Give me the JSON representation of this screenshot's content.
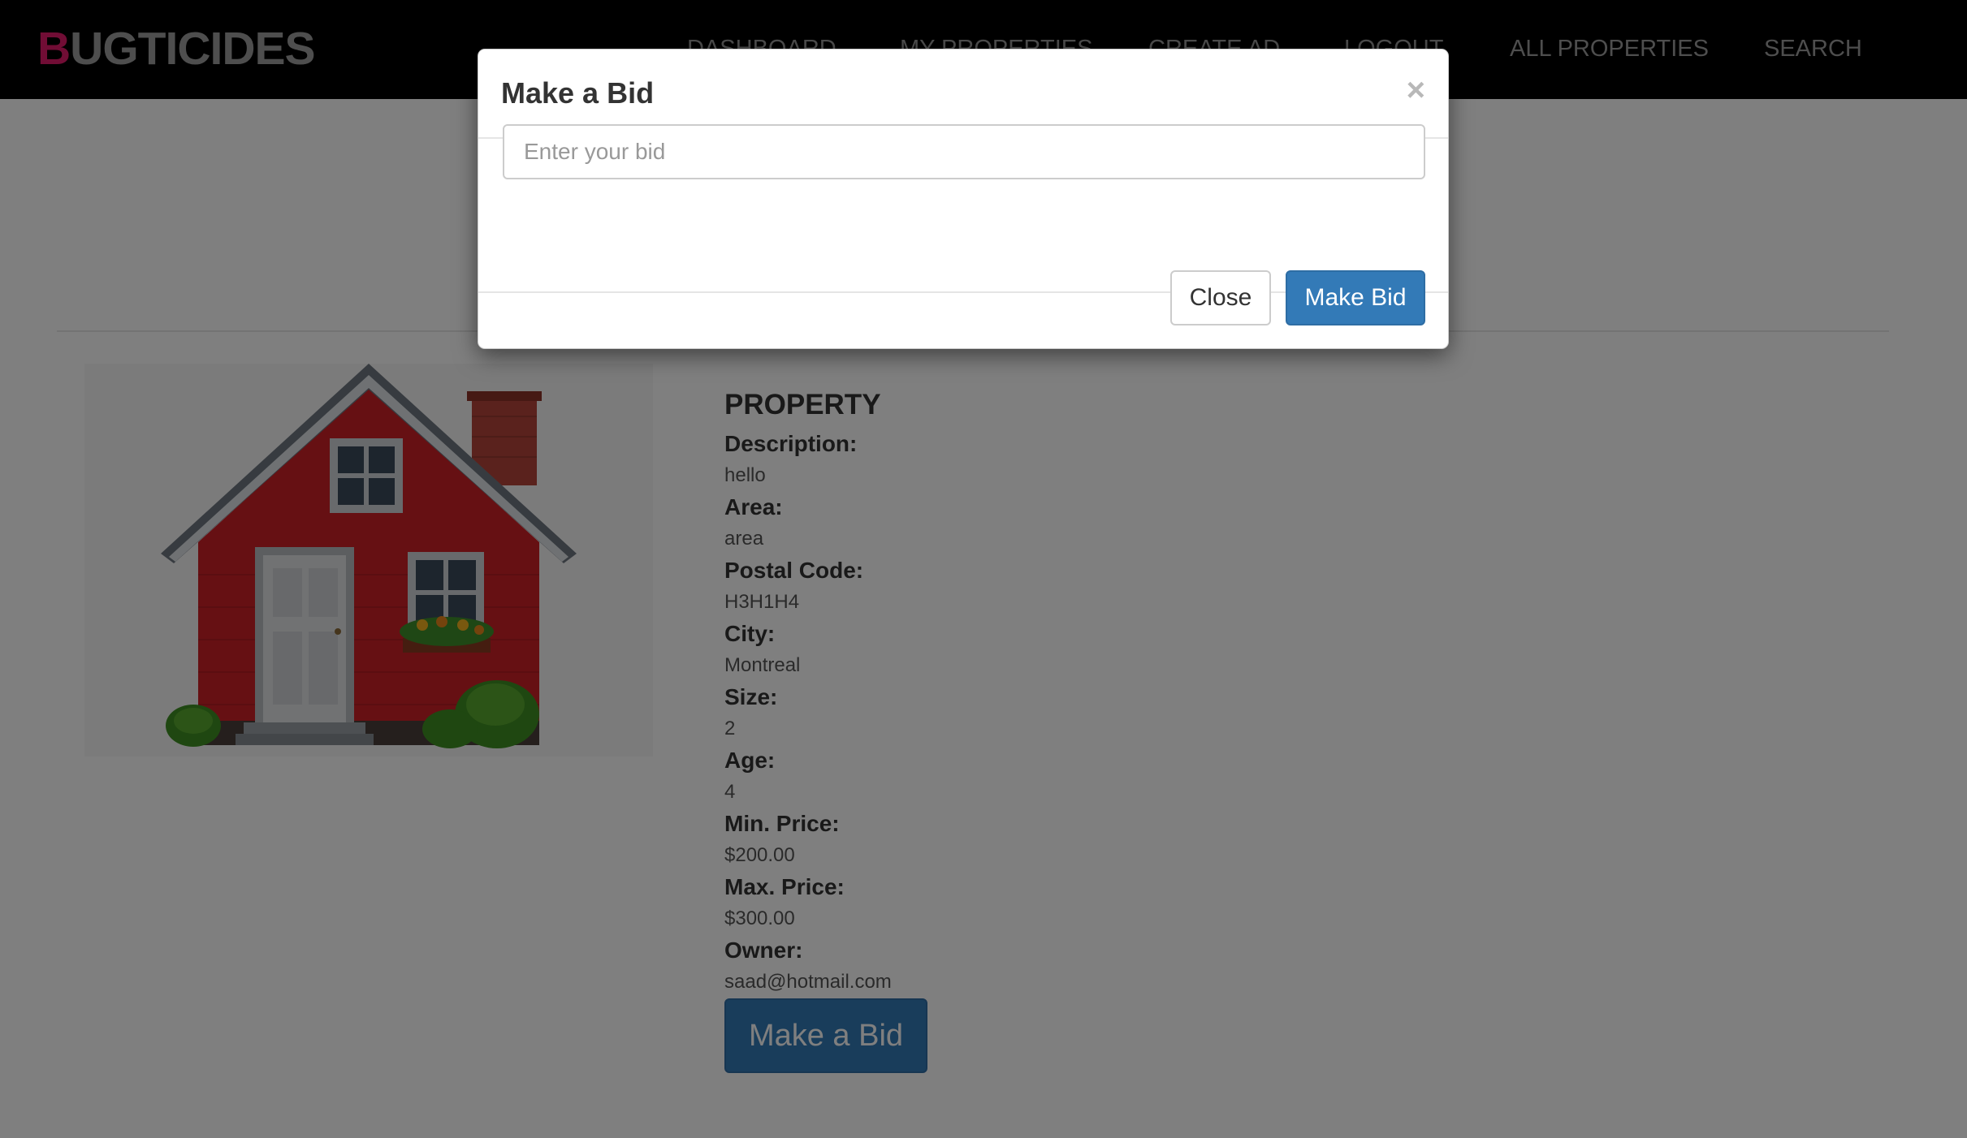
{
  "brand": {
    "first_letter": "B",
    "rest": "UGTICIDES",
    "accent_color": "#e31a6a"
  },
  "nav": {
    "items": [
      {
        "label": "DASHBOARD"
      },
      {
        "label": "MY PROPERTIES"
      },
      {
        "label": "CREATE AD"
      },
      {
        "label": "LOGOUT"
      },
      {
        "label": "ALL PROPERTIES"
      },
      {
        "label": "SEARCH"
      }
    ]
  },
  "property": {
    "heading": "PROPERTY",
    "image_icon": "house-icon",
    "fields": [
      {
        "label": "Description:",
        "value": "hello"
      },
      {
        "label": "Area:",
        "value": "area"
      },
      {
        "label": "Postal Code:",
        "value": "H3H1H4"
      },
      {
        "label": "City:",
        "value": "Montreal"
      },
      {
        "label": "Size:",
        "value": "2"
      },
      {
        "label": "Age:",
        "value": "4"
      },
      {
        "label": "Min. Price:",
        "value": "$200.00"
      },
      {
        "label": "Max. Price:",
        "value": "$300.00"
      },
      {
        "label": "Owner:",
        "value": "saad@hotmail.com"
      }
    ],
    "bid_button_label": "Make a Bid"
  },
  "modal": {
    "title": "Make a Bid",
    "close_x": "×",
    "input_placeholder": "Enter your bid",
    "input_value": "",
    "close_label": "Close",
    "submit_label": "Make Bid",
    "primary_color": "#337ab7"
  }
}
